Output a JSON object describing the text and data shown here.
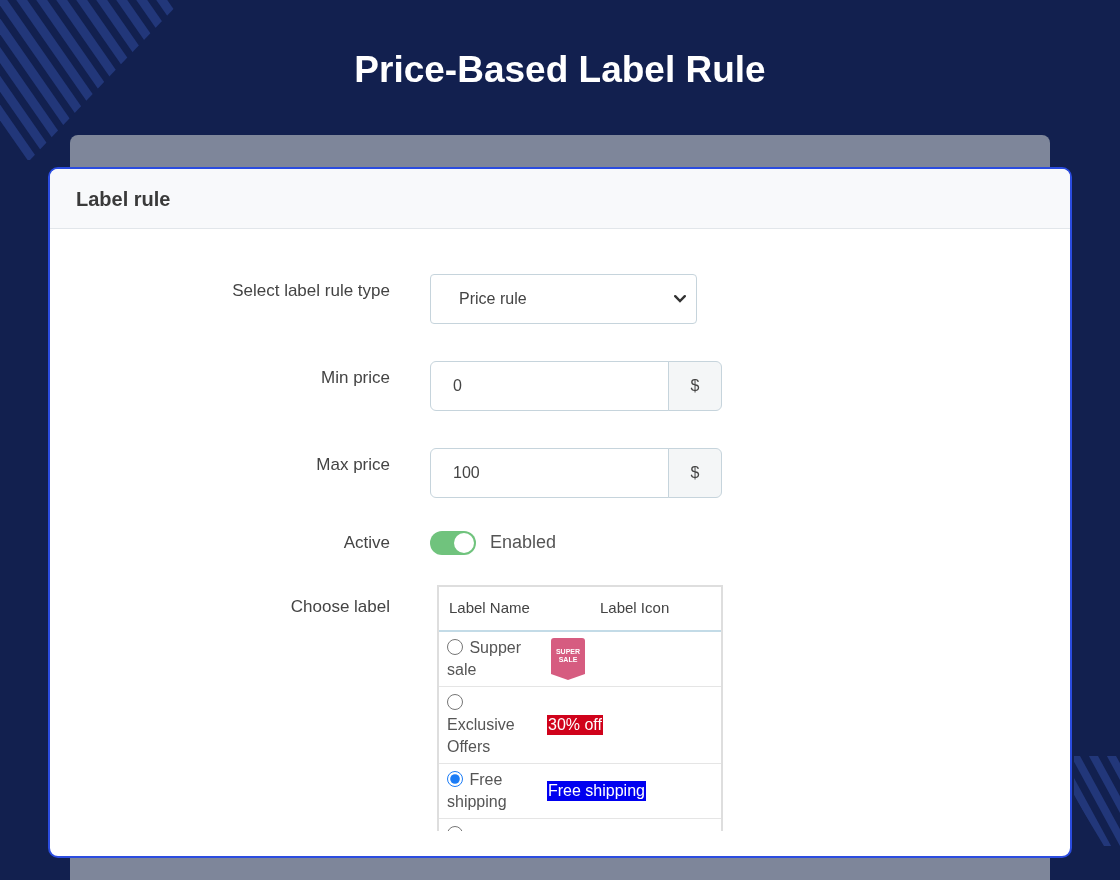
{
  "page_title": "Price-Based Label Rule",
  "card": {
    "title": "Label rule",
    "fields": [
      {
        "kind": "select",
        "label": "Select label rule type",
        "value": "Price rule"
      },
      {
        "kind": "amount",
        "label": "Min price",
        "value": "0",
        "unit": "$"
      },
      {
        "kind": "amount",
        "label": "Max price",
        "value": "100",
        "unit": "$"
      },
      {
        "kind": "switch",
        "label": "Active",
        "on": true,
        "text": "Enabled"
      },
      {
        "kind": "label_table",
        "label": "Choose label",
        "columns": [
          "Label Name",
          "Label Icon"
        ],
        "rows": [
          {
            "name": "Supper sale",
            "selected": false,
            "icon": {
              "kind": "ribbon",
              "text": "SUPER SALE",
              "color": "#d65c80"
            }
          },
          {
            "name": "Exclusive Offers",
            "selected": false,
            "icon": {
              "kind": "text",
              "text": "30% off",
              "color": "#d0021b"
            }
          },
          {
            "name": "Free shipping",
            "selected": true,
            "icon": {
              "kind": "text",
              "text": "Free shipping",
              "color": "#0000f0"
            }
          },
          {
            "selected": false
          }
        ]
      }
    ]
  }
}
